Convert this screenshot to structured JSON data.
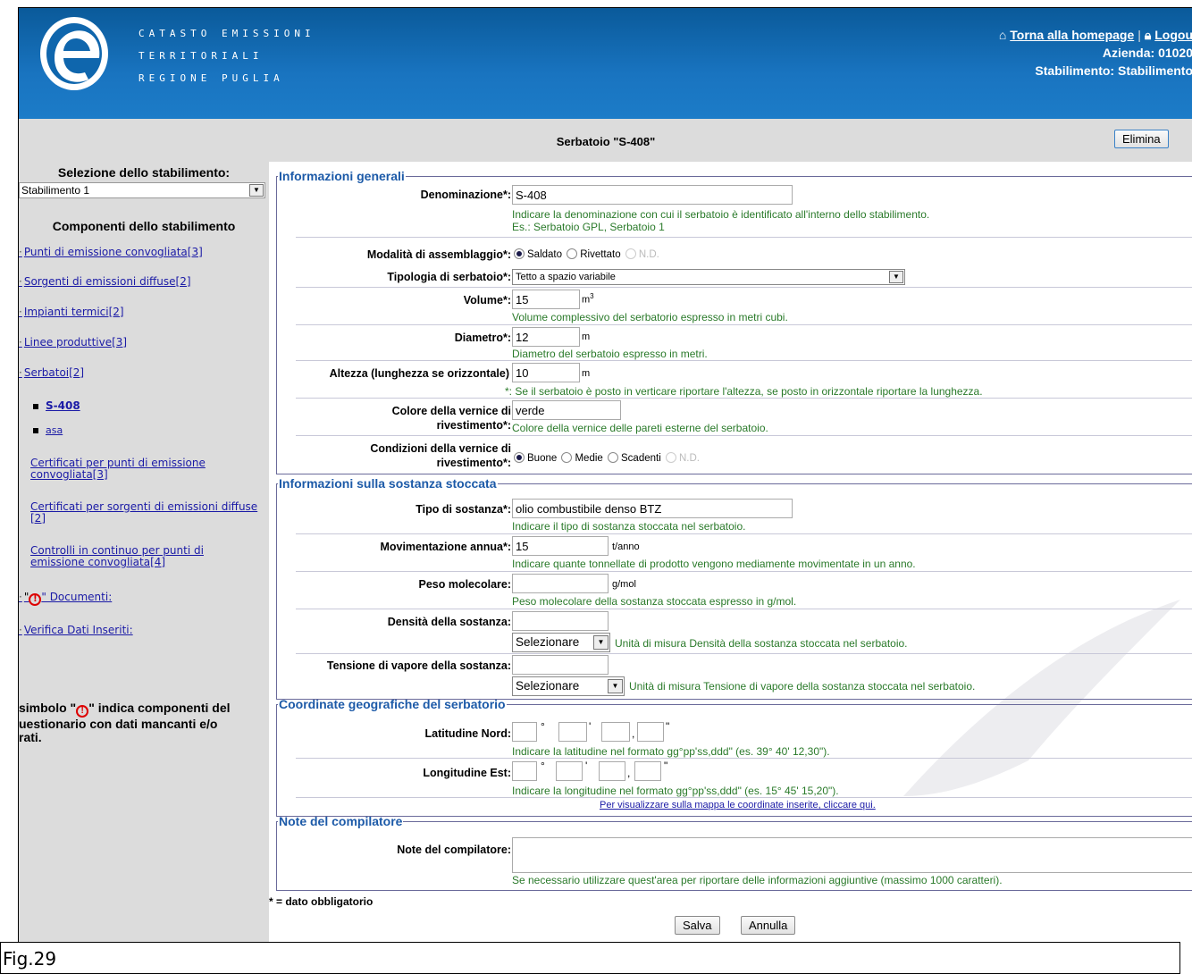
{
  "header": {
    "brand_lines": [
      "Catasto Emissioni",
      "Territoriali",
      "Regione Puglia"
    ],
    "home_link": "Torna alla homepage",
    "logout_link": "Logou",
    "azienda_label": "Azienda:",
    "azienda_value": "01020",
    "stabilimento_label": "Stabilimento:",
    "stabilimento_value": "Stabilimento"
  },
  "titlebar": {
    "title": "Serbatoio \"S-408\"",
    "delete_button": "Elimina"
  },
  "sidebar": {
    "select_heading": "Selezione dello stabilimento:",
    "select_value": "Stabilimento 1",
    "components_heading": "Componenti dello stabilimento",
    "links": [
      "Punti di emissione convogliata[3]",
      "Sorgenti di emissioni diffuse[2]",
      "Impianti termici[2]",
      "Linee produttive[3]",
      "Serbatoi[2]"
    ],
    "serbatoi_items": [
      "S-408",
      "asa"
    ],
    "links2": [
      [
        "Certificati per punti di emissione",
        "convogliata[3]"
      ],
      [
        "Certificati per sorgenti di emissioni diffuse",
        "[2]"
      ],
      [
        "Controlli in continuo per punti di",
        "emissione convogliata[4]"
      ]
    ],
    "documenti_prefix": "\"",
    "documenti_suffix": "\" Documenti:",
    "verifica_link": "Verifica Dati Inseriti:",
    "note_prefix": "simbolo \"",
    "note_suffix": "\" indica componenti del",
    "note_line2": "uestionario con dati mancanti e/o",
    "note_line3": "rati."
  },
  "sections": {
    "general": "Informazioni generali",
    "substance": "Informazioni sulla sostanza stoccata",
    "coords": "Coordinate geografiche del serbatorio",
    "notes": "Note del compilatore"
  },
  "general": {
    "denominazione_label": "Denominazione*:",
    "denominazione_value": "S-408",
    "denominazione_hint1": "Indicare la denominazione con cui il serbatoio è identificato all'interno dello stabilimento.",
    "denominazione_hint2": "Es.: Serbatoio GPL, Serbatoio 1",
    "assemblaggio_label": "Modalità di assemblaggio*:",
    "assemblaggio_options": [
      "Saldato",
      "Rivettato",
      "N.D."
    ],
    "tipologia_label": "Tipologia di serbatoio*:",
    "tipologia_value": "Tetto a spazio variabile",
    "volume_label": "Volume*:",
    "volume_value": "15",
    "volume_unit": "m",
    "volume_hint": "Volume complessivo del serbatorio espresso in metri cubi.",
    "diametro_label": "Diametro*:",
    "diametro_value": "12",
    "diametro_unit": "m",
    "diametro_hint": "Diametro del serbatoio espresso in metri.",
    "altezza_label": "Altezza (lunghezza se orizzontale)",
    "altezza_value": "10",
    "altezza_unit": "m",
    "altezza_hint": "*: Se il serbatoio è posto in verticare riportare l'altezza, se posto in orizzontale riportare la lunghezza.",
    "colore_label1": "Colore della vernice di",
    "colore_label2": "rivestimento*:",
    "colore_value": "verde",
    "colore_hint": "Colore della vernice delle pareti esterne del serbatoio.",
    "condizioni_label1": "Condizioni della vernice di",
    "condizioni_label2": "rivestimento*:",
    "condizioni_options": [
      "Buone",
      "Medie",
      "Scadenti",
      "N.D."
    ]
  },
  "substance": {
    "tipo_label": "Tipo di sostanza*:",
    "tipo_value": "olio combustibile denso BTZ",
    "tipo_hint": "Indicare il tipo di sostanza stoccata nel serbatoio.",
    "mov_label": "Movimentazione annua*:",
    "mov_value": "15",
    "mov_unit": "t/anno",
    "mov_hint": "Indicare quante tonnellate di prodotto vengono mediamente movimentate in un anno.",
    "peso_label": "Peso molecolare:",
    "peso_value": "",
    "peso_unit": "g/mol",
    "peso_hint": "Peso molecolare della sostanza stoccata espresso in g/mol.",
    "densita_label": "Densità della sostanza:",
    "densita_select": "Selezionare",
    "densita_hint": "Unità di misura Densità della sostanza stoccata nel serbatoio.",
    "tensione_label": "Tensione di vapore della sostanza:",
    "tensione_select": "Selezionare",
    "tensione_hint": "Unità di misura Tensione di vapore della sostanza stoccata nel serbatoio."
  },
  "coords": {
    "lat_label": "Latitudine Nord:",
    "lat_hint": "Indicare la latitudine nel formato gg°pp'ss,ddd\" (es. 39° 40' 12,30\").",
    "lon_label": "Longitudine Est:",
    "lon_hint": "Indicare la longitudine nel formato gg°pp'ss,ddd\" (es. 15° 45' 15,20\").",
    "map_link": "Per visualizzare sulla mappa le coordinate inserite, cliccare qui.",
    "sym_deg": "°",
    "sym_min": "'",
    "sym_comma": ",",
    "sym_sec": "\""
  },
  "notes": {
    "label": "Note del compilatore:",
    "value": "",
    "hint": "Se necessario utilizzare quest'area per riportare delle informazioni aggiuntive (massimo 1000 caratteri)."
  },
  "footer": {
    "required_note": "* = dato obbligatorio",
    "save_button": "Salva",
    "cancel_button": "Annulla"
  },
  "caption": "Fig.29",
  "colors": {
    "header_blue": "#1974c0",
    "section_title": "#1c5aa8",
    "hint_green": "#2a7a2a",
    "link_blue": "#1a1aa6",
    "warning_red": "#dd0000"
  }
}
